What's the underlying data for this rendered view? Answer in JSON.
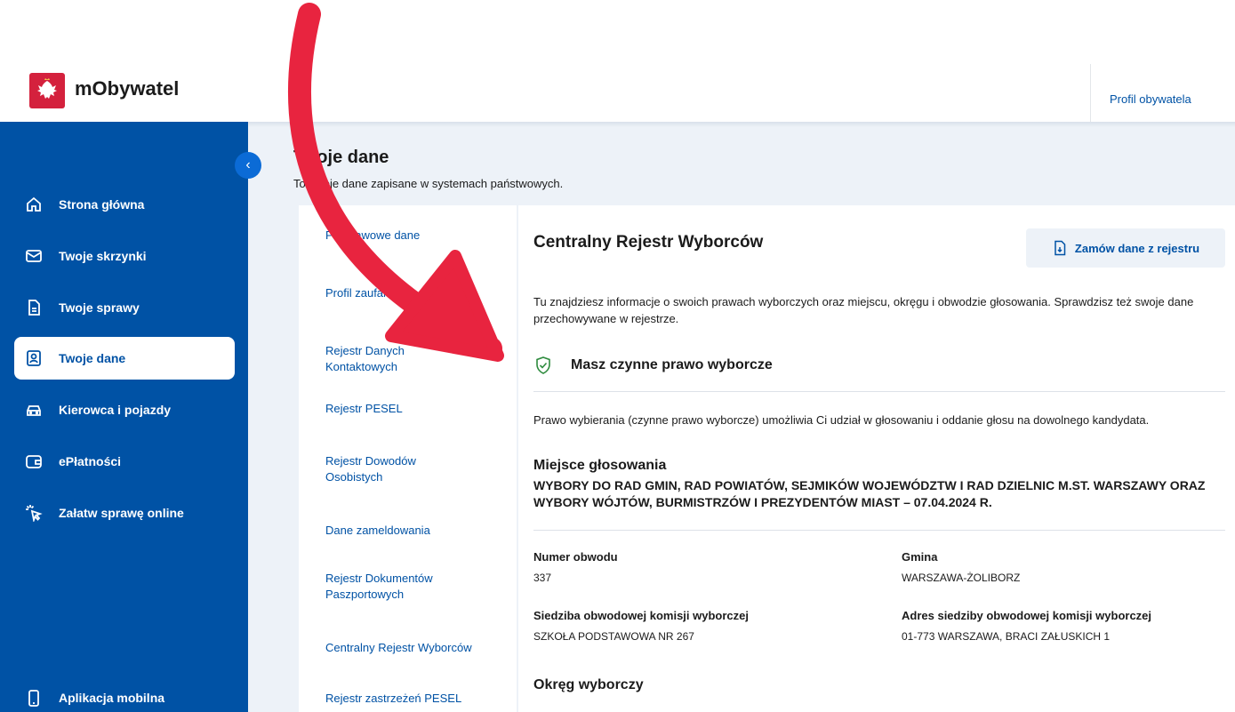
{
  "header": {
    "brand": "mObywatel",
    "profile_link": "Profil obywatela"
  },
  "sidebar": {
    "items": [
      {
        "label": "Strona główna",
        "icon": "home-icon"
      },
      {
        "label": "Twoje skrzynki",
        "icon": "mail-icon"
      },
      {
        "label": "Twoje sprawy",
        "icon": "document-icon"
      },
      {
        "label": "Twoje dane",
        "icon": "id-card-icon",
        "active": true
      },
      {
        "label": "Kierowca i pojazdy",
        "icon": "car-icon"
      },
      {
        "label": "ePłatności",
        "icon": "wallet-icon"
      },
      {
        "label": "Załatw sprawę online",
        "icon": "cursor-click-icon"
      }
    ],
    "bottom_item": {
      "label": "Aplikacja mobilna",
      "icon": "phone-icon"
    }
  },
  "main": {
    "title": "Twoje dane",
    "subtitle": "To Twoje dane zapisane w systemach państwowych."
  },
  "subnav": {
    "items": [
      "Podstawowe dane",
      "Profil zaufany",
      "Rejestr Danych Kontaktowych",
      "Rejestr PESEL",
      "Rejestr Dowodów Osobistych",
      "Dane zameldowania",
      "Rejestr Dokumentów Paszportowych",
      "Centralny Rejestr Wyborców",
      "Rejestr zastrzeżeń PESEL"
    ]
  },
  "content": {
    "title": "Centralny Rejestr Wyborców",
    "order_button": "Zamów dane z rejestru",
    "intro": "Tu znajdziesz informacje o swoich prawach wyborczych oraz miejscu, okręgu i obwodzie głosowania. Sprawdzisz też swoje dane przechowywane w rejestrze.",
    "rights_title": "Masz czynne prawo wyborcze",
    "rights_desc": "Prawo wybierania (czynne prawo wyborcze) umożliwia Ci udział w głosowaniu i oddanie głosu na dowolnego kandydata.",
    "place_title": "Miejsce głosowania",
    "election": "WYBORY DO RAD GMIN, RAD POWIATÓW, SEJMIKÓW WOJEWÓDZTW I RAD DZIELNIC M.ST. WARSZAWY ORAZ WYBORY WÓJTÓW, BURMISTRZÓW I PREZYDENTÓW MIAST – 07.04.2024 R.",
    "fields": {
      "district_number_label": "Numer obwodu",
      "district_number": "337",
      "gmina_label": "Gmina",
      "gmina": "WARSZAWA-ŻOLIBORZ",
      "seat_label": "Siedziba obwodowej komisji wyborczej",
      "seat": "SZKOŁA PODSTAWOWA NR 267",
      "address_label": "Adres siedziby obwodowej komisji wyborczej",
      "address": "01-773 WARSZAWA, BRACI ZAŁUSKICH 1"
    },
    "district_title": "Okręg wyborczy"
  },
  "colors": {
    "brand_blue": "#0052a5",
    "arrow_red": "#e8243f",
    "logo_red": "#d4213d"
  }
}
